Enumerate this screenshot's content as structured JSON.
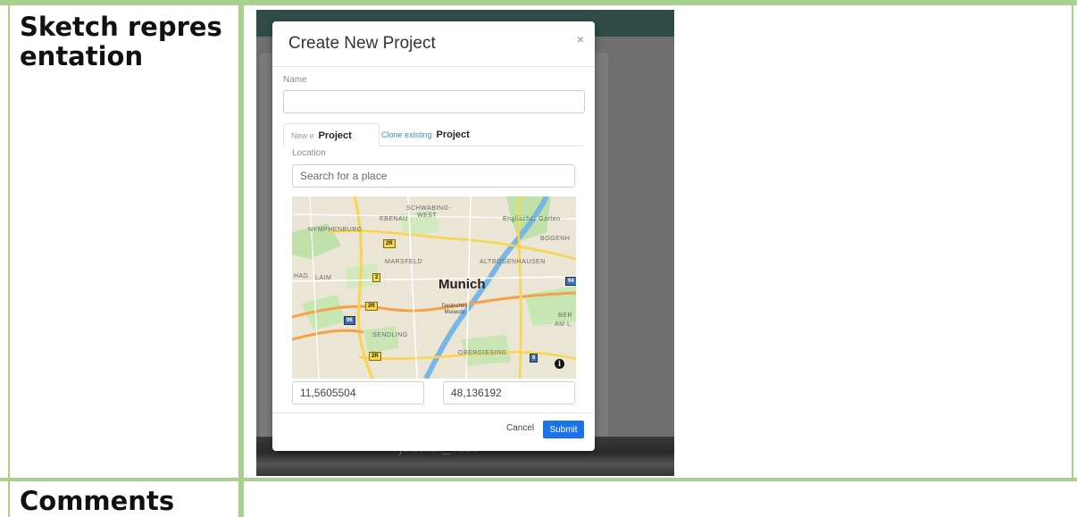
{
  "document": {
    "row1_label": "Sketch representation",
    "row2_label": "Comments"
  },
  "modal": {
    "title": "Create New Project",
    "close_glyph": "×",
    "name_label": "Name",
    "name_value": "",
    "tabs": [
      {
        "prefix": "New e",
        "label": "Project",
        "active": true
      },
      {
        "prefix": "Clone existing",
        "label": "Project",
        "active": false
      }
    ],
    "location_label": "Location",
    "search_placeholder": "Search for a place",
    "map": {
      "city": "Munich",
      "districts": [
        "SCHWABING-",
        "WEST",
        "EBENAU",
        "NYMPHENBURG",
        "Englischer Garten",
        "BOGENH",
        "MARSFELD",
        "ALTBOGENHAUSEN",
        "HAD",
        "LAIM",
        "SENDLING",
        "OBERGIESING",
        "BER",
        "AM L"
      ],
      "poi": [
        "Deutsches",
        "Museum"
      ],
      "road_shields": [
        "2R",
        "2",
        "2R",
        "96",
        "2R",
        "8",
        "94"
      ]
    },
    "coord_1": "11,5605504",
    "coord_2": "48,136192",
    "cancel_label": "Cancel",
    "submit_label": "Submit"
  },
  "background": {
    "partial_text": "jeddan_Test"
  },
  "colors": {
    "table_border": "#a9d18e",
    "submit_bg": "#1a73e8",
    "header_bar": "#2f4c47"
  }
}
